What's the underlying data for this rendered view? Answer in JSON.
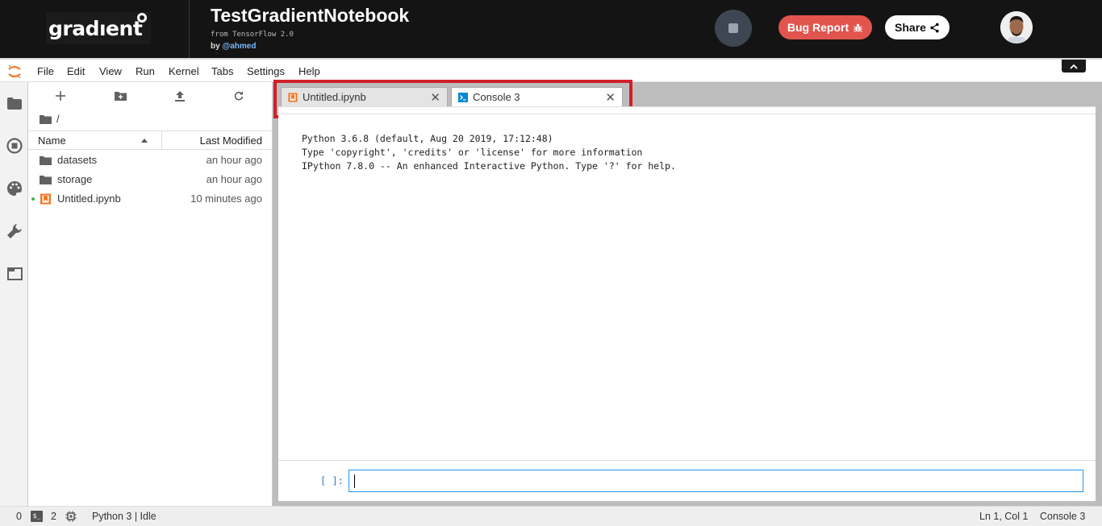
{
  "header": {
    "logo_text": "gradıent",
    "notebook_title": "TestGradientNotebook",
    "subtitle": "from TensorFlow 2.0",
    "by_prefix": "by",
    "author": "@ahmed",
    "bug_report_label": "Bug Report",
    "share_label": "Share"
  },
  "menu": {
    "items": [
      "File",
      "Edit",
      "View",
      "Run",
      "Kernel",
      "Tabs",
      "Settings",
      "Help"
    ]
  },
  "file_browser": {
    "path": "/",
    "columns": {
      "name": "Name",
      "modified": "Last Modified"
    },
    "rows": [
      {
        "name": "datasets",
        "modified": "an hour ago",
        "type": "folder"
      },
      {
        "name": "storage",
        "modified": "an hour ago",
        "type": "folder"
      },
      {
        "name": "Untitled.ipynb",
        "modified": "10 minutes ago",
        "type": "notebook"
      }
    ]
  },
  "tabs": [
    {
      "label": "Untitled.ipynb",
      "icon": "notebook-icon",
      "active": false
    },
    {
      "label": "Console 3",
      "icon": "console-icon",
      "active": true
    }
  ],
  "console": {
    "banner_line1": "Python 3.6.8 (default, Aug 20 2019, 17:12:48)",
    "banner_line2": "Type 'copyright', 'credits' or 'license' for more information",
    "banner_line3": "IPython 7.8.0 -- An enhanced Interactive Python. Type '?' for help.",
    "prompt": "[ ]:",
    "input_value": ""
  },
  "status": {
    "count_left": "0",
    "terminals_count": "2",
    "kernel_status": "Python 3 | Idle",
    "cursor_position": "Ln 1, Col 1",
    "active_document": "Console 3"
  },
  "colors": {
    "header_bg": "#141414",
    "bug_report": "#e2554f",
    "highlight": "#d01f2b",
    "prompt_blue": "#307fc1"
  }
}
